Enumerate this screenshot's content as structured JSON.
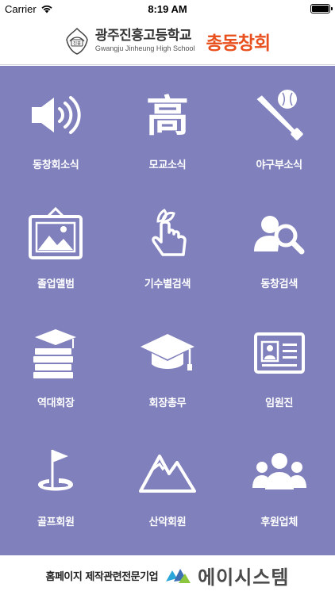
{
  "status_bar": {
    "carrier": "Carrier",
    "time": "8:19 AM"
  },
  "header": {
    "emblem_text": "진흥",
    "school_name": "광주진흥고등학교",
    "school_english": "Gwangju Jinheung High School",
    "alumni_title": "총동창회",
    "alumni_color": "#e8501e"
  },
  "menu": {
    "background": "#8080bd",
    "items": [
      {
        "label": "동창회소식",
        "icon": "speaker-icon"
      },
      {
        "label": "모교소식",
        "icon": "hanja-high-icon",
        "glyph": "高"
      },
      {
        "label": "야구부소식",
        "icon": "baseball-bat-icon"
      },
      {
        "label": "졸업앨범",
        "icon": "picture-frame-icon"
      },
      {
        "label": "기수별검색",
        "icon": "sprout-hand-icon"
      },
      {
        "label": "동창검색",
        "icon": "user-search-icon"
      },
      {
        "label": "역대회장",
        "icon": "books-cap-icon"
      },
      {
        "label": "회장총무",
        "icon": "graduation-cap-icon"
      },
      {
        "label": "임원진",
        "icon": "id-card-icon"
      },
      {
        "label": "골프회원",
        "icon": "golf-flag-icon"
      },
      {
        "label": "산악회원",
        "icon": "mountain-icon"
      },
      {
        "label": "후원업체",
        "icon": "group-icon"
      }
    ]
  },
  "footer": {
    "text": "홈페이지 제작관련전문기업",
    "company": "에이시스템"
  }
}
